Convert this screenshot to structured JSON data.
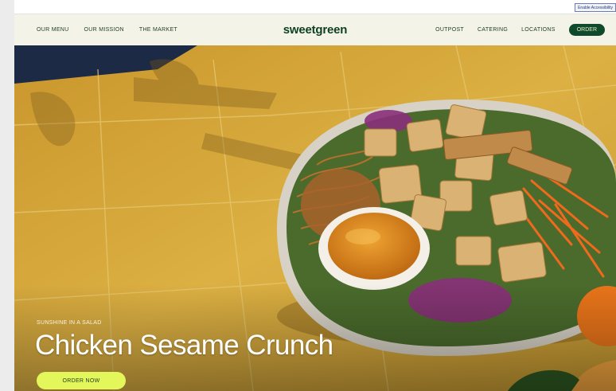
{
  "accessibility": {
    "label": "Enable Accessibility"
  },
  "nav": {
    "left_items": [
      "OUR MENU",
      "OUR MISSION",
      "THE MARKET"
    ],
    "logo": "sweetgreen",
    "right_items": [
      "OUTPOST",
      "CATERING",
      "LOCATIONS"
    ],
    "order_label": "ORDER"
  },
  "hero": {
    "eyebrow": "SUNSHINE IN A SALAD",
    "headline": "Chicken Sesame Crunch",
    "cta_label": "ORDER NOW"
  },
  "colors": {
    "brand_green": "#0e4a2c",
    "cta_yellow": "#e4f75a",
    "tile_mustard": "#d4a93a",
    "nav_background": "#f4f3e7"
  }
}
